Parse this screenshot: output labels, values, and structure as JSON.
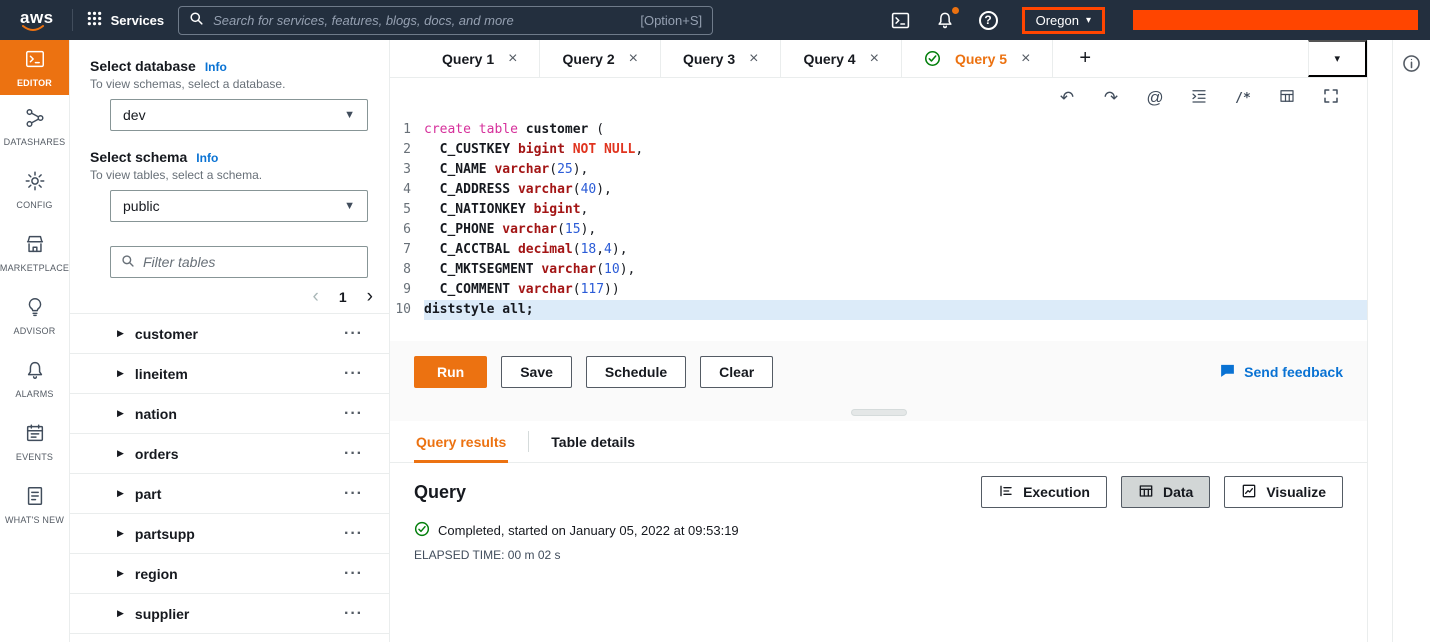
{
  "topbar": {
    "logo": "aws",
    "services_label": "Services",
    "search_placeholder": "Search for services, features, blogs, docs, and more",
    "search_shortcut": "[Option+S]",
    "region_label": "Oregon",
    "nav_bg": "#232f3e",
    "accent_orange": "#ec7211",
    "annotation_color": "#ff4500"
  },
  "rail": {
    "items": [
      {
        "label": "EDITOR",
        "icon": "editor-icon",
        "active": true
      },
      {
        "label": "DATASHARES",
        "icon": "share-icon",
        "active": false
      },
      {
        "label": "CONFIG",
        "icon": "gear-icon",
        "active": false
      },
      {
        "label": "MARKETPLACE",
        "icon": "store-icon",
        "active": false
      },
      {
        "label": "ADVISOR",
        "icon": "bulb-icon",
        "active": false
      },
      {
        "label": "ALARMS",
        "icon": "bell-icon",
        "active": false
      },
      {
        "label": "EVENTS",
        "icon": "calendar-icon",
        "active": false
      },
      {
        "label": "WHAT'S NEW",
        "icon": "doc-icon",
        "active": false
      }
    ]
  },
  "sidebar": {
    "database_label": "Select database",
    "database_info": "Info",
    "database_help": "To view schemas, select a database.",
    "database_value": "dev",
    "schema_label": "Select schema",
    "schema_info": "Info",
    "schema_help": "To view tables, select a schema.",
    "schema_value": "public",
    "filter_placeholder": "Filter tables",
    "page_number": "1",
    "tables": [
      "customer",
      "lineitem",
      "nation",
      "orders",
      "part",
      "partsupp",
      "region",
      "supplier"
    ]
  },
  "query_tabs": {
    "tabs": [
      {
        "label": "Query 1",
        "active": false
      },
      {
        "label": "Query 2",
        "active": false
      },
      {
        "label": "Query 3",
        "active": false
      },
      {
        "label": "Query 4",
        "active": false
      },
      {
        "label": "Query 5",
        "active": true
      }
    ]
  },
  "editor_toolbar": {
    "icons": [
      "undo-icon",
      "redo-icon",
      "at-icon",
      "indent-icon",
      "comment-icon",
      "snippet-icon",
      "fullscreen-icon"
    ]
  },
  "editor": {
    "active_line": 10,
    "syntax_colors": {
      "keyword": "#d6309b",
      "type": "#a31515",
      "constraint": "#e0341f",
      "number": "#2a5bd7",
      "identifier": "#16191f"
    },
    "lines": [
      [
        {
          "t": "create table ",
          "c": "kw"
        },
        {
          "t": "customer",
          "c": "id"
        },
        {
          "t": " (",
          "c": "pl"
        }
      ],
      [
        {
          "t": "  ",
          "c": "pl"
        },
        {
          "t": "C_CUSTKEY",
          "c": "id"
        },
        {
          "t": " ",
          "c": "pl"
        },
        {
          "t": "bigint",
          "c": "ty"
        },
        {
          "t": " ",
          "c": "pl"
        },
        {
          "t": "NOT NULL",
          "c": "nn"
        },
        {
          "t": ",",
          "c": "pl"
        }
      ],
      [
        {
          "t": "  ",
          "c": "pl"
        },
        {
          "t": "C_NAME",
          "c": "id"
        },
        {
          "t": " ",
          "c": "pl"
        },
        {
          "t": "varchar",
          "c": "ty"
        },
        {
          "t": "(",
          "c": "pl"
        },
        {
          "t": "25",
          "c": "num"
        },
        {
          "t": "),",
          "c": "pl"
        }
      ],
      [
        {
          "t": "  ",
          "c": "pl"
        },
        {
          "t": "C_ADDRESS",
          "c": "id"
        },
        {
          "t": " ",
          "c": "pl"
        },
        {
          "t": "varchar",
          "c": "ty"
        },
        {
          "t": "(",
          "c": "pl"
        },
        {
          "t": "40",
          "c": "num"
        },
        {
          "t": "),",
          "c": "pl"
        }
      ],
      [
        {
          "t": "  ",
          "c": "pl"
        },
        {
          "t": "C_NATIONKEY",
          "c": "id"
        },
        {
          "t": " ",
          "c": "pl"
        },
        {
          "t": "bigint",
          "c": "ty"
        },
        {
          "t": ",",
          "c": "pl"
        }
      ],
      [
        {
          "t": "  ",
          "c": "pl"
        },
        {
          "t": "C_PHONE",
          "c": "id"
        },
        {
          "t": " ",
          "c": "pl"
        },
        {
          "t": "varchar",
          "c": "ty"
        },
        {
          "t": "(",
          "c": "pl"
        },
        {
          "t": "15",
          "c": "num"
        },
        {
          "t": "),",
          "c": "pl"
        }
      ],
      [
        {
          "t": "  ",
          "c": "pl"
        },
        {
          "t": "C_ACCTBAL",
          "c": "id"
        },
        {
          "t": " ",
          "c": "pl"
        },
        {
          "t": "decimal",
          "c": "ty"
        },
        {
          "t": "(",
          "c": "pl"
        },
        {
          "t": "18",
          "c": "num"
        },
        {
          "t": ",",
          "c": "pl"
        },
        {
          "t": "4",
          "c": "num"
        },
        {
          "t": "),",
          "c": "pl"
        }
      ],
      [
        {
          "t": "  ",
          "c": "pl"
        },
        {
          "t": "C_MKTSEGMENT",
          "c": "id"
        },
        {
          "t": " ",
          "c": "pl"
        },
        {
          "t": "varchar",
          "c": "ty"
        },
        {
          "t": "(",
          "c": "pl"
        },
        {
          "t": "10",
          "c": "num"
        },
        {
          "t": "),",
          "c": "pl"
        }
      ],
      [
        {
          "t": "  ",
          "c": "pl"
        },
        {
          "t": "C_COMMENT",
          "c": "id"
        },
        {
          "t": " ",
          "c": "pl"
        },
        {
          "t": "varchar",
          "c": "ty"
        },
        {
          "t": "(",
          "c": "pl"
        },
        {
          "t": "117",
          "c": "num"
        },
        {
          "t": "))",
          "c": "pl"
        }
      ],
      [
        {
          "t": "diststyle all;",
          "c": "id"
        }
      ]
    ]
  },
  "actions": {
    "run": "Run",
    "save": "Save",
    "schedule": "Schedule",
    "clear": "Clear",
    "feedback": "Send feedback"
  },
  "results": {
    "tabs": [
      {
        "label": "Query results",
        "active": true
      },
      {
        "label": "Table details",
        "active": false
      }
    ],
    "heading": "Query",
    "buttons": [
      {
        "label": "Execution",
        "icon": "execution-icon",
        "selected": false
      },
      {
        "label": "Data",
        "icon": "table-icon",
        "selected": true
      },
      {
        "label": "Visualize",
        "icon": "chart-icon",
        "selected": false
      }
    ],
    "status_text": "Completed, started on January 05, 2022 at 09:53:19",
    "elapsed_text": "ELAPSED TIME: 00 m 02 s"
  }
}
